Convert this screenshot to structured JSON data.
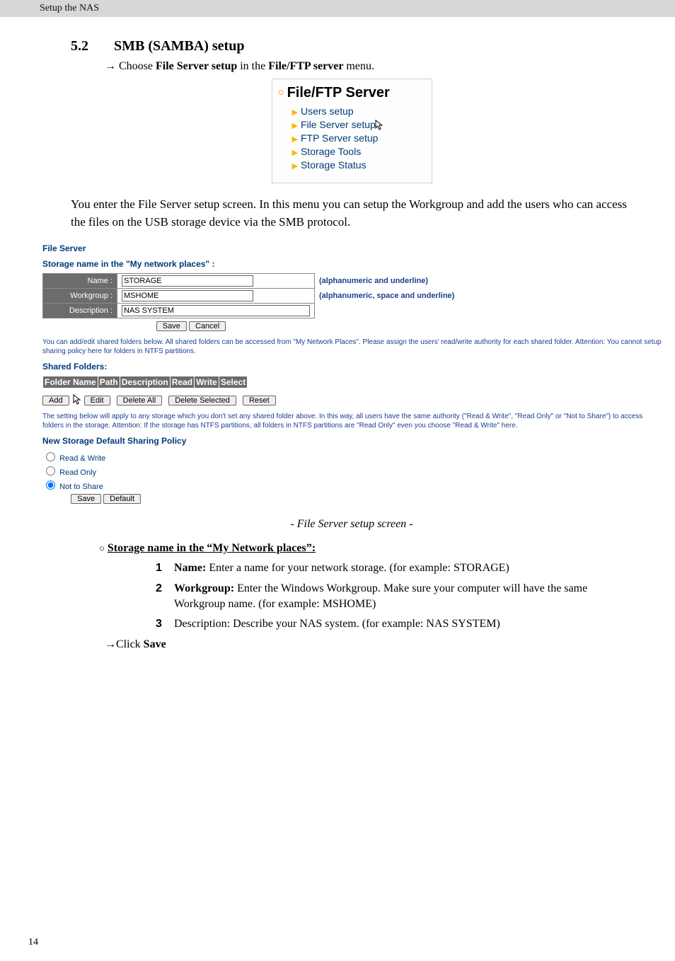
{
  "header": {
    "breadcrumb": "Setup the NAS"
  },
  "section": {
    "number": "5.2",
    "title": "SMB (SAMBA) setup",
    "choose_line_prefix": "Choose ",
    "choose_bold1": "File Server setup",
    "choose_mid": " in the ",
    "choose_bold2": "File/FTP server",
    "choose_suffix": " menu."
  },
  "menu": {
    "title": "File/FTP Server",
    "items": [
      "Users setup",
      "File Server setup",
      "FTP Server setup",
      "Storage Tools",
      "Storage Status"
    ]
  },
  "intro_para": "You enter the File Server setup screen. In this menu you can setup the Workgroup and add the users who can access the files on the USB storage device via the SMB protocol.",
  "fs": {
    "heading": "File Server",
    "storage_heading": "Storage name in the \"My network places\"  :",
    "rows": {
      "name_label": "Name  :",
      "name_value": "STORAGE",
      "name_hint": "(alphanumeric and underline)",
      "workgroup_label": "Workgroup  :",
      "workgroup_value": "MSHOME",
      "workgroup_hint": "(alphanumeric, space and underline)",
      "desc_label": "Description  :",
      "desc_value": "NAS SYSTEM"
    },
    "save": "Save",
    "cancel": "Cancel",
    "note1": "You can add/edit shared folders below. All shared folders can be accessed from \"My Network Places\". Please assign the users' read/write authority for each shared folder. Attention: You cannot setup sharing policy here for folders in NTFS partitions.",
    "shared_heading": "Shared Folders:",
    "cols": [
      "Folder Name",
      "Path",
      "Description",
      "Read",
      "Write",
      "Select"
    ],
    "btns": {
      "add": "Add",
      "edit": "Edit",
      "delall": "Delete All",
      "delsel": "Delete Selected",
      "reset": "Reset"
    },
    "note2": "The setting below will apply to any storage which you don't set any shared folder above. In this way, all users have the same authority (\"Read & Write\", \"Read Only\" or \"Not to Share\") to access folders in the storage. Attention: If the storage has NTFS partitions, all folders in NTFS partitions are \"Read Only\" even you choose \"Read & Write\" here.",
    "policy_heading": "New Storage Default Sharing Policy",
    "radios": {
      "rw": "Read & Write",
      "ro": "Read Only",
      "ns": "Not to Share"
    },
    "save2": "Save",
    "default": "Default"
  },
  "caption": "- File Server setup screen -",
  "subsec": {
    "title": "Storage name in the “My Network places”:",
    "items": [
      {
        "n": "1",
        "bold": "Name:",
        "text": " Enter a name for your network storage. (for example: STORAGE)"
      },
      {
        "n": "2",
        "bold": "Workgroup:",
        "text": " Enter the Windows Workgroup. Make sure your computer will have the same Workgroup name. (for example: MSHOME)"
      },
      {
        "n": "3",
        "bold": "",
        "text": "Description: Describe your NAS system. (for example: NAS SYSTEM)"
      }
    ],
    "click_prefix": "Click ",
    "click_bold": "Save"
  },
  "page_number": "14"
}
